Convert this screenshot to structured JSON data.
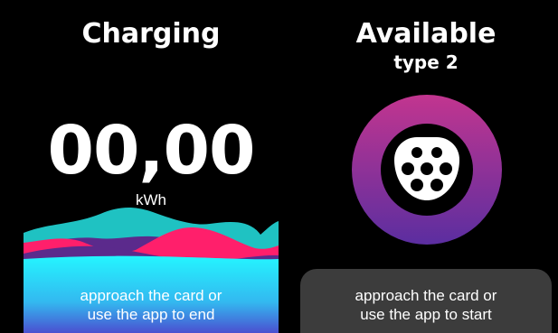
{
  "charging_panel": {
    "status_title": "Charging",
    "energy_value": "00,00",
    "energy_unit": "kWh",
    "instruction_line1": "approach the card or",
    "instruction_line2": "use the app to end"
  },
  "available_panel": {
    "status_title": "Available",
    "connector_type": "type 2",
    "connector_icon": "type2-connector-icon",
    "instruction_line1": "approach the card or",
    "instruction_line2": "use the app to start"
  },
  "colors": {
    "background": "#000000",
    "ring_top": "#c2358f",
    "ring_bottom": "#5b2ea0",
    "wave_teal": "#1fc2c2",
    "wave_pink": "#ff1f6b",
    "wave_purple": "#5b2a8c",
    "wave_cyan": "#24f5ff",
    "wave_blue": "#4b4fd0",
    "instruction_box": "#3c3c3c"
  }
}
